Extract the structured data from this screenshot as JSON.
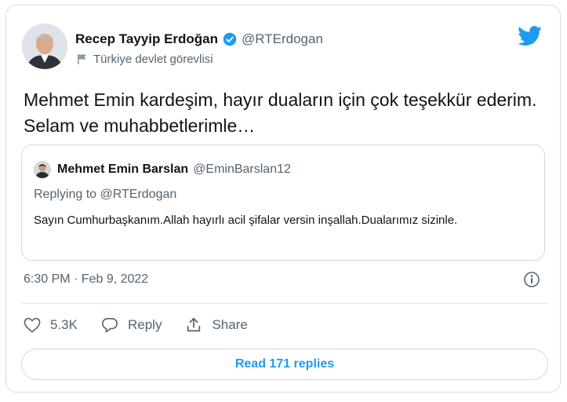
{
  "tweet": {
    "author_name": "Recep Tayyip Erdoğan",
    "author_handle": "@RTErdogan",
    "author_label": "Türkiye devlet görevlisi",
    "text": "Mehmet Emin kardeşim, hayır duaların için çok teşekkür ederim. Selam ve muhabbetlerimle…",
    "timestamp": "6:30 PM · Feb 9, 2022",
    "like_count": "5.3K",
    "reply_label": "Reply",
    "share_label": "Share",
    "read_replies_label": "Read 171 replies"
  },
  "quoted": {
    "author_name": "Mehmet Emin Barslan",
    "author_handle": "@EminBarslan12",
    "replying_to": "Replying to @RTErdogan",
    "text": "Sayın Cumhurbaşkanım.Allah hayırlı acil şifalar versin inşallah.Dualarımız sizinle."
  },
  "icons": {
    "verified": "verified-badge-icon",
    "label_flag": "flag-icon",
    "brand": "twitter-bird-icon",
    "info": "info-icon",
    "like": "heart-icon",
    "reply": "reply-bubble-icon",
    "share": "share-icon"
  },
  "colors": {
    "accent": "#1d9bf0",
    "text": "#0f1419",
    "secondary_text": "#536471",
    "border": "#cfd9de"
  }
}
